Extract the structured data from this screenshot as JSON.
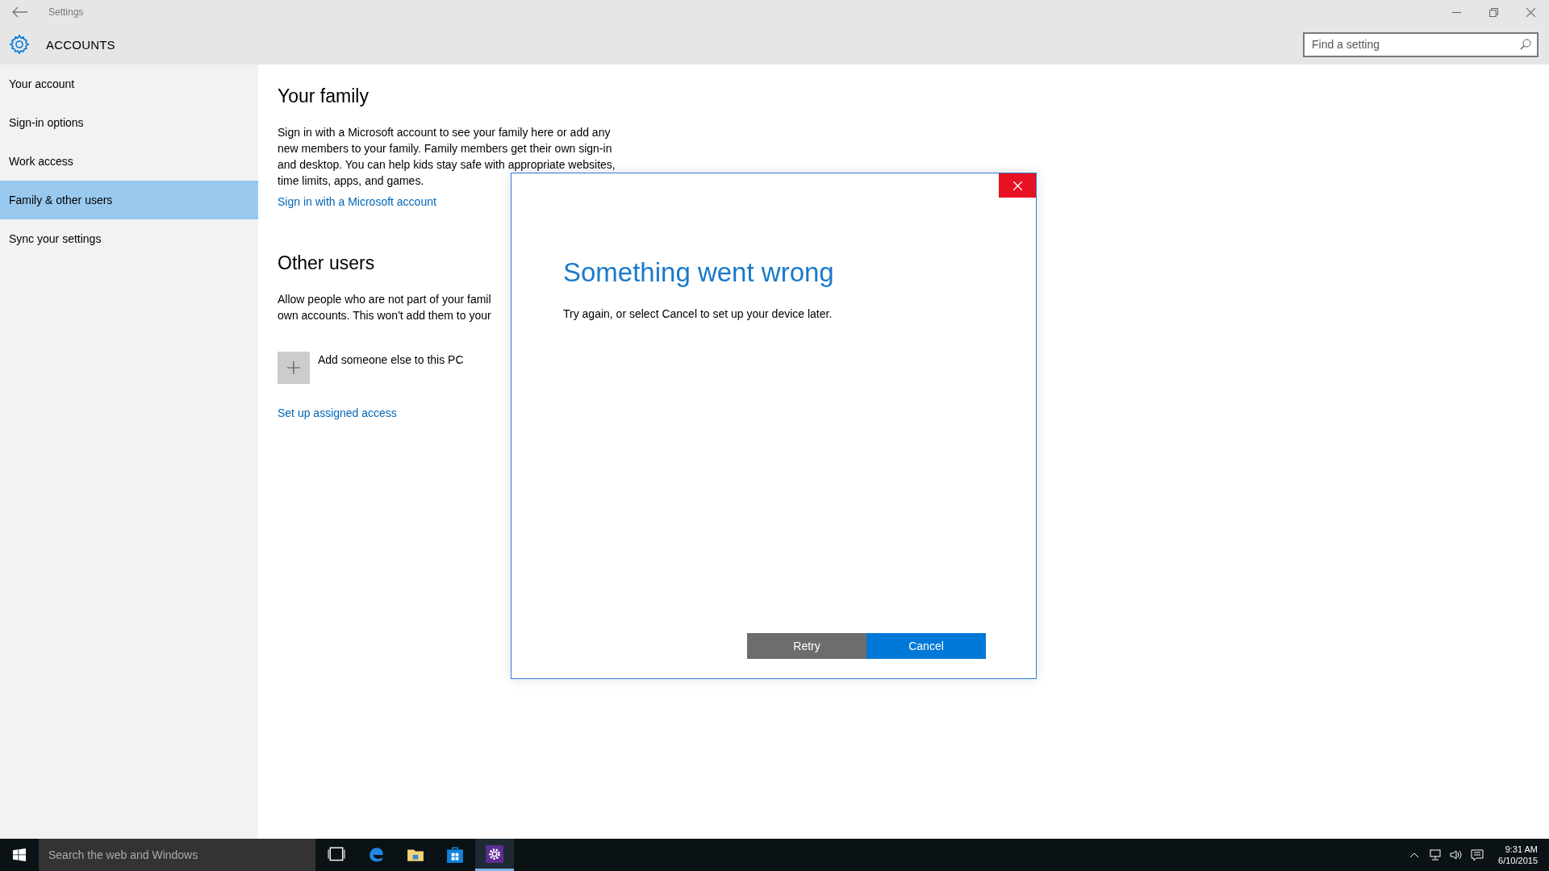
{
  "window": {
    "title": "Settings"
  },
  "header": {
    "title": "ACCOUNTS"
  },
  "search": {
    "placeholder": "Find a setting"
  },
  "sidebar": {
    "items": [
      {
        "label": "Your account",
        "selected": false
      },
      {
        "label": "Sign-in options",
        "selected": false
      },
      {
        "label": "Work access",
        "selected": false
      },
      {
        "label": "Family & other users",
        "selected": true
      },
      {
        "label": "Sync your settings",
        "selected": false
      }
    ]
  },
  "family": {
    "heading": "Your family",
    "text_lines": [
      "Sign in with a Microsoft account to see your family here or add any",
      "new members to your family. Family members get their own sign-in",
      "and desktop. You can help kids stay safe with appropriate websites,",
      "time limits, apps, and games."
    ],
    "link": "Sign in with a Microsoft account"
  },
  "other_users": {
    "heading": "Other users",
    "text_lines": [
      "Allow people who are not part of your famil",
      "own accounts. This won't add them to your"
    ],
    "add_button": {
      "label": "Add someone else to this PC"
    },
    "link": "Set up assigned access"
  },
  "dialog": {
    "title": "Something went wrong",
    "message": "Try again, or select Cancel to set up your device later.",
    "buttons": [
      {
        "label": "Retry",
        "kind": "secondary"
      },
      {
        "label": "Cancel",
        "kind": "primary"
      }
    ]
  },
  "taskbar": {
    "search_placeholder": "Search the web and Windows",
    "apps": [
      {
        "kind": "task-view",
        "active": false
      },
      {
        "kind": "edge",
        "active": false
      },
      {
        "kind": "explorer",
        "active": false
      },
      {
        "kind": "store",
        "active": false
      },
      {
        "kind": "settings",
        "active": true
      }
    ],
    "clock": {
      "time": "9:31 AM",
      "date": "6/10/2015"
    }
  }
}
